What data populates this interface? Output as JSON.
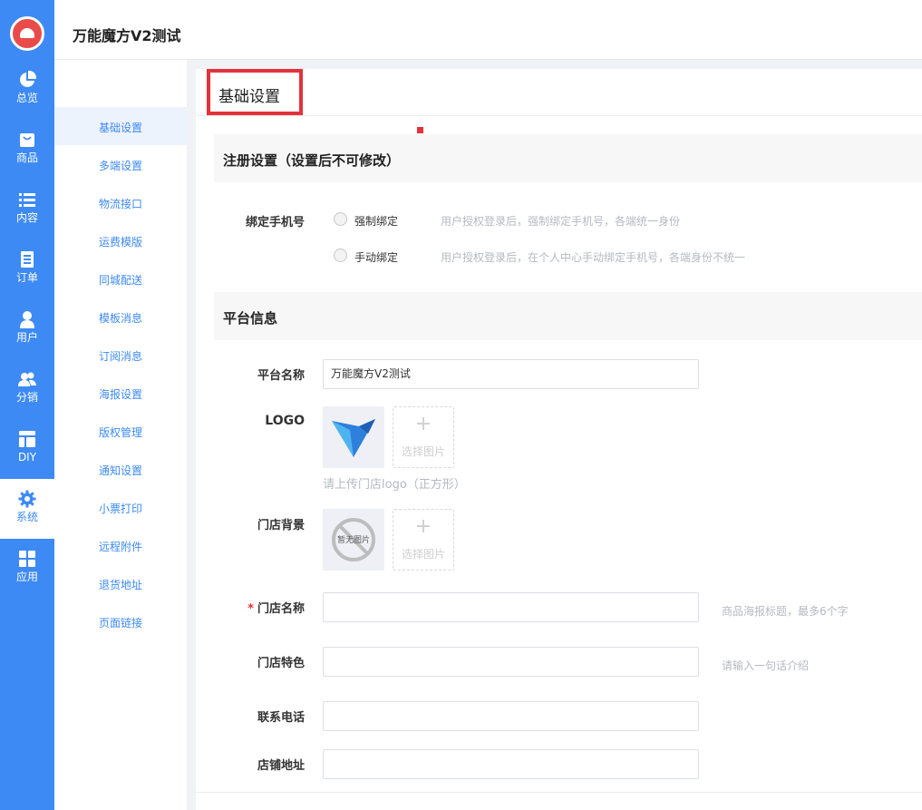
{
  "app": {
    "title": "万能魔方V2测试"
  },
  "nav": {
    "items": [
      {
        "label": "总览",
        "icon": "pie-chart-icon"
      },
      {
        "label": "商品",
        "icon": "shopping-bag-icon"
      },
      {
        "label": "内容",
        "icon": "list-icon"
      },
      {
        "label": "订单",
        "icon": "order-icon"
      },
      {
        "label": "用户",
        "icon": "user-icon"
      },
      {
        "label": "分销",
        "icon": "users-icon"
      },
      {
        "label": "DIY",
        "icon": "layout-icon"
      },
      {
        "label": "系统",
        "icon": "gear-icon",
        "active": true
      },
      {
        "label": "应用",
        "icon": "apps-grid-icon"
      }
    ]
  },
  "submenu": {
    "items": [
      "基础设置",
      "多端设置",
      "物流接口",
      "运费模版",
      "同城配送",
      "模板消息",
      "订阅消息",
      "海报设置",
      "版权管理",
      "通知设置",
      "小票打印",
      "远程附件",
      "退货地址",
      "页面链接"
    ],
    "active": "基础设置"
  },
  "page": {
    "title": "基础设置"
  },
  "register": {
    "section_title": "注册设置（设置后不可修改）",
    "bind_label": "绑定手机号",
    "options": [
      {
        "label": "强制绑定",
        "hint": "用户授权登录后，强制绑定手机号，各端统一身份"
      },
      {
        "label": "手动绑定",
        "hint": "用户授权登录后，在个人中心手动绑定手机号，各端身份不统一"
      }
    ]
  },
  "platform": {
    "section_title": "平台信息",
    "name_label": "平台名称",
    "name_value": "万能魔方V2测试",
    "logo_label": "LOGO",
    "logo_hint": "请上传门店logo（正方形）",
    "upload_text": "选择图片",
    "bg_label": "门店背景",
    "no_image_text": "暂无图片",
    "store_name_label": "门店名称",
    "store_name_hint": "商品海报标题，最多6个字",
    "store_feature_label": "门店特色",
    "store_feature_hint": "请输入一句话介绍",
    "phone_label": "联系电话",
    "address_label": "店铺地址"
  },
  "colors": {
    "accent": "#3d8af5",
    "highlight": "#e3323b"
  }
}
